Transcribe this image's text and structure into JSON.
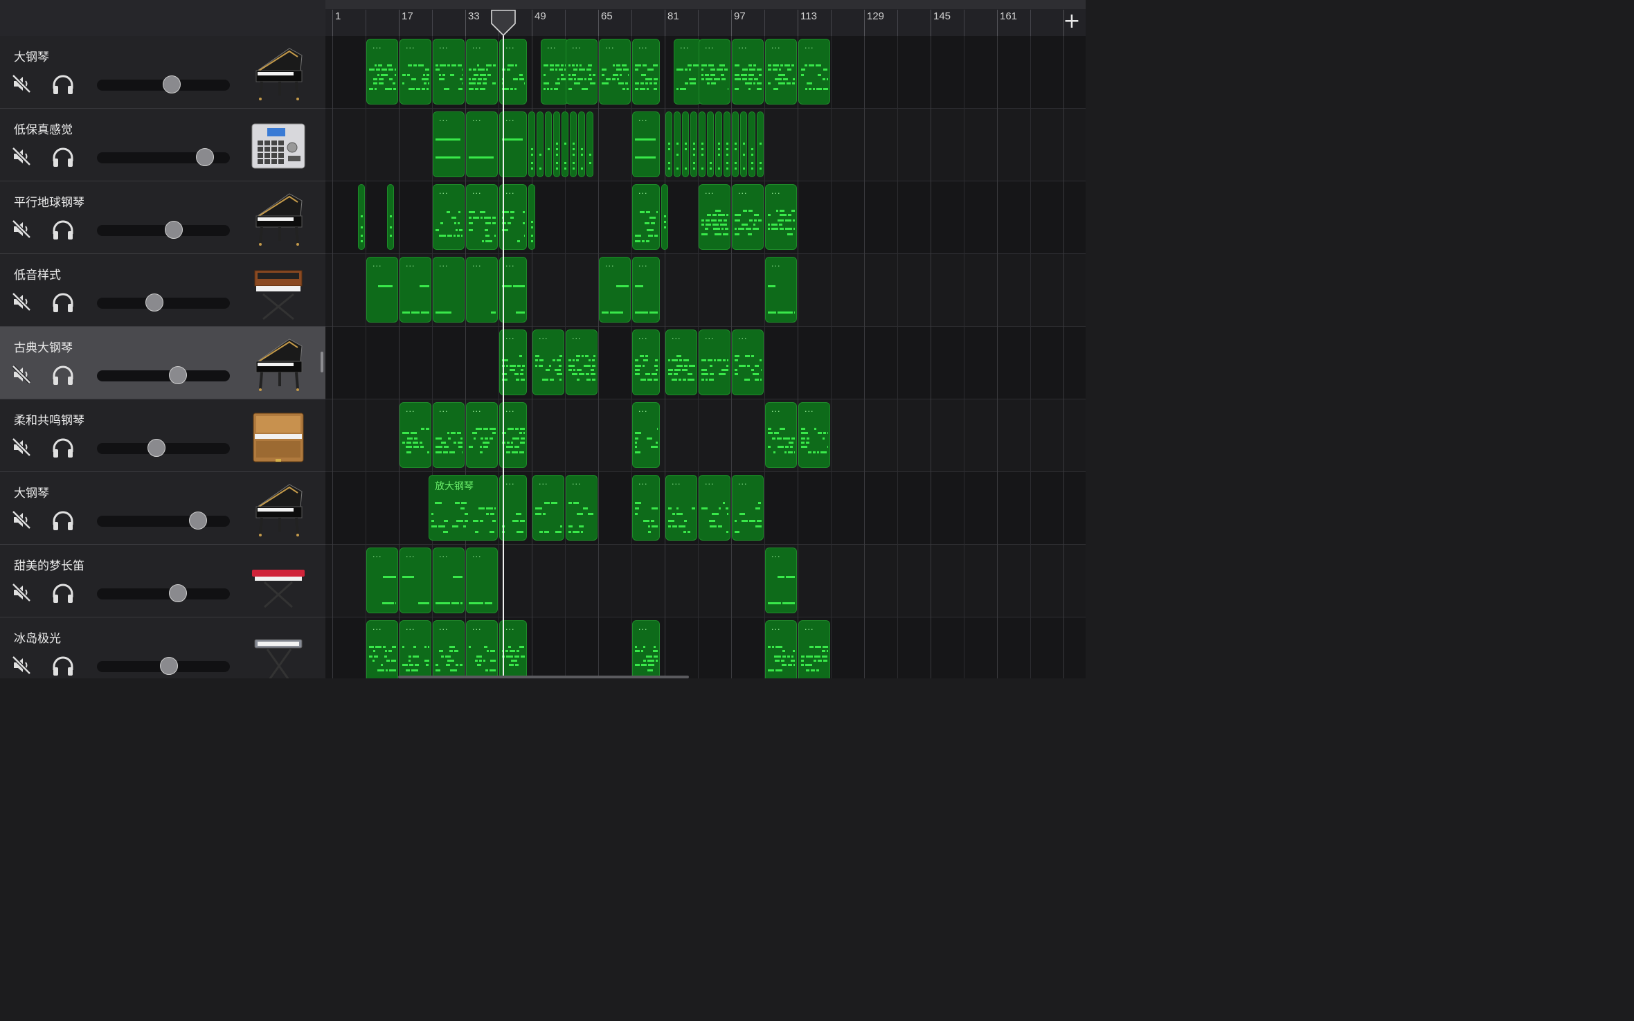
{
  "ruler": {
    "labels": [
      "1",
      "17",
      "33",
      "49",
      "65",
      "81",
      "97",
      "113",
      "129",
      "145",
      "161"
    ],
    "add_label": "+"
  },
  "playhead": {
    "bar": 42
  },
  "tracks": [
    {
      "name": "大钢琴",
      "instrument": "grand-piano",
      "volume": 0.56,
      "regions": [
        [
          9,
          16,
          "m"
        ],
        [
          17,
          24,
          "m"
        ],
        [
          25,
          32,
          "m"
        ],
        [
          33,
          40,
          "m"
        ],
        [
          41,
          47,
          "m"
        ],
        [
          51,
          57,
          "m"
        ],
        [
          57,
          64,
          "m"
        ],
        [
          65,
          72,
          "m"
        ],
        [
          73,
          79,
          "m"
        ],
        [
          83,
          89,
          "m"
        ],
        [
          89,
          96,
          "m"
        ],
        [
          97,
          104,
          "m"
        ],
        [
          105,
          112,
          "m"
        ],
        [
          113,
          120,
          "m"
        ]
      ]
    },
    {
      "name": "低保真感觉",
      "instrument": "drum-machine",
      "volume": 0.81,
      "regions": [
        [
          25,
          32,
          "d"
        ],
        [
          33,
          40,
          "d"
        ],
        [
          41,
          47,
          "d"
        ],
        [
          48,
          49,
          "t"
        ],
        [
          50,
          51,
          "t"
        ],
        [
          52,
          53,
          "t"
        ],
        [
          54,
          55,
          "t"
        ],
        [
          56,
          57,
          "t"
        ],
        [
          58,
          59,
          "t"
        ],
        [
          60,
          61,
          "t"
        ],
        [
          62,
          63,
          "t"
        ],
        [
          73,
          79,
          "d"
        ],
        [
          81,
          82,
          "t"
        ],
        [
          83,
          84,
          "t"
        ],
        [
          85,
          86,
          "t"
        ],
        [
          87,
          88,
          "t"
        ],
        [
          89,
          90,
          "t"
        ],
        [
          91,
          92,
          "t"
        ],
        [
          93,
          94,
          "t"
        ],
        [
          95,
          96,
          "t"
        ],
        [
          97,
          98,
          "t"
        ],
        [
          99,
          100,
          "t"
        ],
        [
          101,
          102,
          "t"
        ],
        [
          103,
          104,
          "t"
        ]
      ]
    },
    {
      "name": "平行地球钢琴",
      "instrument": "grand-piano",
      "volume": 0.58,
      "regions": [
        [
          7,
          8,
          "t"
        ],
        [
          14,
          15,
          "t"
        ],
        [
          25,
          32,
          "s"
        ],
        [
          33,
          40,
          "s"
        ],
        [
          41,
          47,
          "s"
        ],
        [
          48,
          49,
          "t"
        ],
        [
          73,
          79,
          "s"
        ],
        [
          80,
          81,
          "t"
        ],
        [
          89,
          96,
          "m"
        ],
        [
          97,
          104,
          "m"
        ],
        [
          105,
          112,
          "m"
        ]
      ]
    },
    {
      "name": "低音样式",
      "instrument": "synth",
      "volume": 0.43,
      "regions": [
        [
          9,
          16,
          "b"
        ],
        [
          17,
          24,
          "b"
        ],
        [
          25,
          32,
          "b"
        ],
        [
          33,
          40,
          "b"
        ],
        [
          41,
          47,
          "b"
        ],
        [
          65,
          72,
          "b"
        ],
        [
          73,
          79,
          "b"
        ],
        [
          105,
          112,
          "b"
        ]
      ]
    },
    {
      "name": "古典大钢琴",
      "instrument": "grand-piano",
      "volume": 0.61,
      "selected": true,
      "regions": [
        [
          41,
          47,
          "m"
        ],
        [
          49,
          56,
          "m"
        ],
        [
          57,
          64,
          "m"
        ],
        [
          73,
          79,
          "m"
        ],
        [
          81,
          88,
          "m"
        ],
        [
          89,
          96,
          "m"
        ],
        [
          97,
          104,
          "m"
        ]
      ]
    },
    {
      "name": "柔和共鸣钢琴",
      "instrument": "upright-piano",
      "volume": 0.45,
      "regions": [
        [
          17,
          24,
          "m"
        ],
        [
          25,
          32,
          "m"
        ],
        [
          33,
          40,
          "m"
        ],
        [
          41,
          47,
          "m"
        ],
        [
          73,
          79,
          "m"
        ],
        [
          105,
          112,
          "m"
        ],
        [
          113,
          120,
          "m"
        ]
      ]
    },
    {
      "name": "大钢琴",
      "instrument": "grand-piano",
      "volume": 0.76,
      "regions": [
        [
          24,
          40,
          "s",
          "放大钢琴"
        ],
        [
          41,
          47,
          "s"
        ],
        [
          49,
          56,
          "s"
        ],
        [
          57,
          64,
          "s"
        ],
        [
          73,
          79,
          "s"
        ],
        [
          81,
          88,
          "s"
        ],
        [
          89,
          96,
          "s"
        ],
        [
          97,
          104,
          "s"
        ]
      ]
    },
    {
      "name": "甜美的梦长笛",
      "instrument": "red-keyboard",
      "volume": 0.61,
      "regions": [
        [
          9,
          16,
          "b"
        ],
        [
          17,
          24,
          "b"
        ],
        [
          25,
          32,
          "b"
        ],
        [
          33,
          40,
          "b"
        ],
        [
          105,
          112,
          "b"
        ]
      ]
    },
    {
      "name": "冰岛极光",
      "instrument": "keyboard-stand",
      "volume": 0.54,
      "regions": [
        [
          9,
          16,
          "m"
        ],
        [
          17,
          24,
          "m"
        ],
        [
          25,
          32,
          "m"
        ],
        [
          33,
          40,
          "m"
        ],
        [
          41,
          47,
          "m"
        ],
        [
          73,
          79,
          "m"
        ],
        [
          105,
          112,
          "m"
        ],
        [
          113,
          120,
          "m"
        ]
      ]
    }
  ],
  "icons": {
    "mute": "speaker-muted-icon",
    "solo": "headphones-icon",
    "add": "plus-icon"
  },
  "colors": {
    "region_fill": "#0e6b1a",
    "note": "#39e84a",
    "selected_track": "#4a4a4e"
  }
}
